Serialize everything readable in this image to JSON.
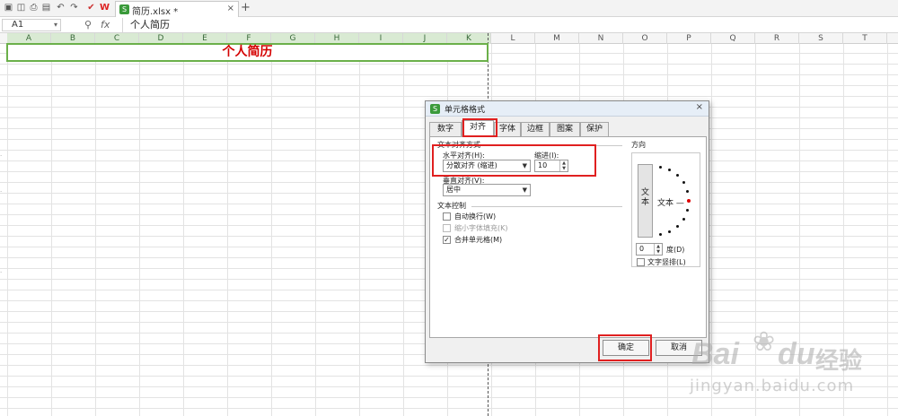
{
  "app": {
    "doc_tab": "简历.xlsx *",
    "toolbar_icons": [
      "save-icon",
      "print-preview-icon",
      "print-icon",
      "export-icon",
      "undo-icon",
      "redo-icon",
      "format-painter-icon",
      "wps-icon"
    ]
  },
  "formula_bar": {
    "cell_ref": "A1",
    "fx_label": "fx",
    "content": "个人简历"
  },
  "sheet": {
    "columns": [
      "A",
      "B",
      "C",
      "D",
      "E",
      "F",
      "G",
      "H",
      "I",
      "J",
      "K",
      "L",
      "M",
      "N",
      "O",
      "P",
      "Q",
      "R",
      "S",
      "T"
    ],
    "title_cell": "个人简历"
  },
  "dialog": {
    "title": "单元格格式",
    "close_glyph": "×",
    "tabs": [
      "数字",
      "对齐",
      "字体",
      "边框",
      "图案",
      "保护"
    ],
    "active_tab": "对齐",
    "text_alignment_section": "文本对齐方式",
    "horizontal_label": "水平对齐(H):",
    "horizontal_value": "分散对齐 (缩进)",
    "indent_label": "缩进(I):",
    "indent_value": "10",
    "vertical_label": "垂直对齐(V):",
    "vertical_value": "居中",
    "text_control_section": "文本控制",
    "wrap_text": "自动换行(W)",
    "shrink_to_fit": "缩小字体填充(K)",
    "merge_cells": "合并单元格(M)",
    "orientation_section": "方向",
    "vertical_text_chars": [
      "文",
      "本"
    ],
    "dial_text": "文本 —",
    "degree_value": "0",
    "degree_label": "度(D)",
    "vertical_stack": "文字竖排(L)",
    "ok": "确定",
    "cancel": "取消"
  },
  "watermark": {
    "brand": "Bai",
    "brand2": "du",
    "sub": "经验",
    "url": "jingyan.baidu.com"
  },
  "colors": {
    "title_text": "#d40000",
    "title_border": "#6bb04a",
    "highlight": "#e02020"
  }
}
